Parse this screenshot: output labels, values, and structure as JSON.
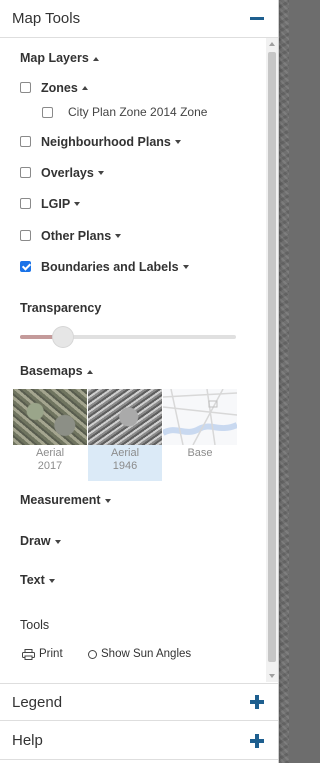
{
  "panel": {
    "map_tools": {
      "title": "Map Tools",
      "toggle_icon": "minus-icon"
    },
    "legend": {
      "title": "Legend",
      "toggle_icon": "plus-icon"
    },
    "help": {
      "title": "Help",
      "toggle_icon": "plus-icon"
    }
  },
  "map_layers": {
    "heading": "Map Layers",
    "items": [
      {
        "label": "Zones",
        "checked": false,
        "expanded": true
      },
      {
        "label": "City Plan Zone 2014 Zone",
        "checked": false,
        "sub": true
      },
      {
        "label": "Neighbourhood Plans",
        "checked": false,
        "expanded": false
      },
      {
        "label": "Overlays",
        "checked": false,
        "expanded": false
      },
      {
        "label": "LGIP",
        "checked": false,
        "expanded": false
      },
      {
        "label": "Other Plans",
        "checked": false,
        "expanded": false
      },
      {
        "label": "Boundaries and Labels",
        "checked": true,
        "expanded": false
      }
    ]
  },
  "transparency": {
    "label": "Transparency",
    "value": 0.2
  },
  "basemaps": {
    "heading": "Basemaps",
    "options": [
      {
        "caption_line1": "Aerial",
        "caption_line2": "2017",
        "selected": false
      },
      {
        "caption_line1": "Aerial",
        "caption_line2": "1946",
        "selected": true
      },
      {
        "caption_line1": "Base",
        "caption_line2": "",
        "selected": false
      }
    ]
  },
  "measurement": {
    "label": "Measurement"
  },
  "draw": {
    "label": "Draw"
  },
  "text_tool": {
    "label": "Text"
  },
  "tools": {
    "heading": "Tools",
    "print_label": "Print",
    "sun_label": "Show Sun Angles"
  },
  "colors": {
    "accent": "#1e5f8f",
    "checkbox": "#1a73e8",
    "selected_bg": "#dbeaf7"
  }
}
